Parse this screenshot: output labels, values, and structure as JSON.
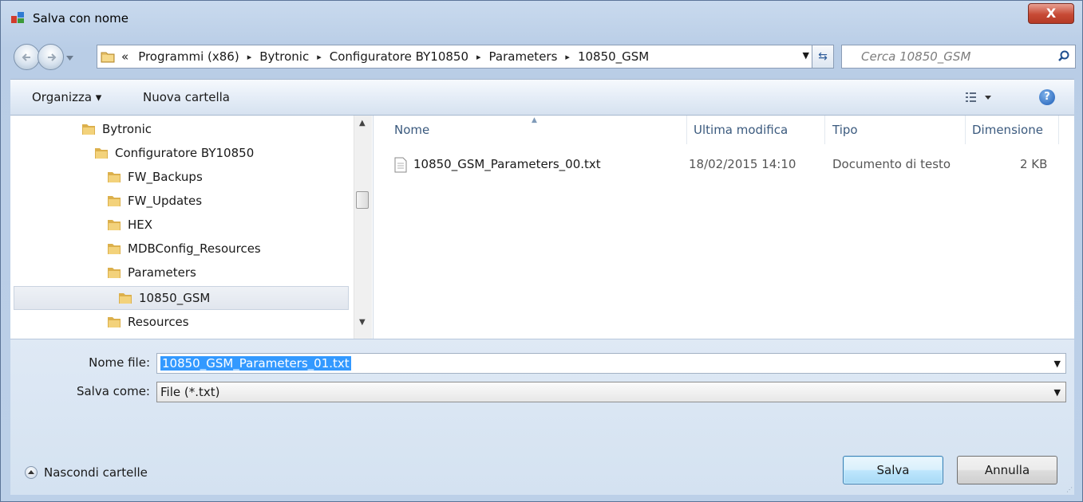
{
  "window": {
    "title": "Salva con nome",
    "close_label": "X"
  },
  "address": {
    "crumbs": [
      "«",
      "Programmi (x86)",
      "Bytronic",
      "Configuratore BY10850",
      "Parameters",
      "10850_GSM"
    ],
    "separator": "▸"
  },
  "search": {
    "placeholder": "Cerca 10850_GSM"
  },
  "toolbar": {
    "organize_label": "Organizza ▾",
    "new_folder_label": "Nuova cartella",
    "help_label": "?"
  },
  "tree": {
    "items": [
      {
        "label": "Bytronic"
      },
      {
        "label": "Configuratore BY10850"
      },
      {
        "label": "FW_Backups"
      },
      {
        "label": "FW_Updates"
      },
      {
        "label": "HEX"
      },
      {
        "label": "MDBConfig_Resources"
      },
      {
        "label": "Parameters"
      },
      {
        "label": "10850_GSM",
        "selected": true
      },
      {
        "label": "Resources"
      }
    ]
  },
  "files": {
    "columns": [
      "Nome",
      "Ultima modifica",
      "Tipo",
      "Dimensione"
    ],
    "rows": [
      {
        "name": "10850_GSM_Parameters_00.txt",
        "modified": "18/02/2015 14:10",
        "type": "Documento di testo",
        "size": "2 KB"
      }
    ]
  },
  "form": {
    "filename_label": "Nome file:",
    "filename_value": "10850_GSM_Parameters_01.txt",
    "savetype_label": "Salva come:",
    "savetype_value": "File (*.txt)"
  },
  "footer": {
    "hide_folders_label": "Nascondi cartelle",
    "save_label": "Salva",
    "cancel_label": "Annulla"
  },
  "colors": {
    "selection": "#3399ff",
    "close_button": "#c74a35",
    "header_text": "#3b5a7e"
  }
}
